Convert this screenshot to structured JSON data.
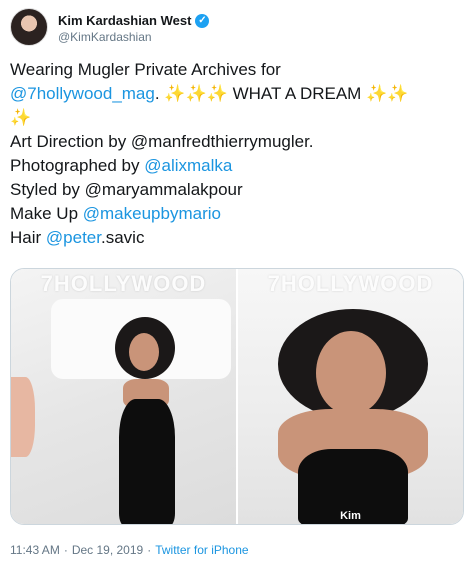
{
  "author": {
    "name": "Kim Kardashian West",
    "handle": "@KimKardashian",
    "verified_icon": "verified-badge-icon"
  },
  "tweet": {
    "line1": "Wearing Mugler Private Archives for",
    "mag_mention": "@7hollywood_mag",
    "period": ".",
    "sparkles_a": "✨✨✨",
    "dream": "WHAT A DREAM",
    "sparkles_b": "✨✨",
    "sparkles_c": "✨",
    "art_direction": "Art Direction by @manfredthierrymugler.",
    "photographed_prefix": "Photographed by",
    "photographer": "@alixmalka",
    "styled": "Styled by @maryammalakpour",
    "makeup_prefix": "Make Up",
    "makeup": "@makeupbymario",
    "hair_prefix": "Hair",
    "hair_mention": "@peter",
    "hair_suffix": ".savic"
  },
  "media": {
    "left_title": "7HOLLYWOOD",
    "right_title": "7HOLLYWOOD",
    "right_caption": "Kim"
  },
  "footer": {
    "time": "11:43 AM",
    "separator": "·",
    "date": "Dec 19, 2019",
    "separator2": "·",
    "source": "Twitter for iPhone"
  },
  "colors": {
    "link": "#1b95e0",
    "verified": "#1da1f2",
    "secondary_text": "#657786"
  }
}
